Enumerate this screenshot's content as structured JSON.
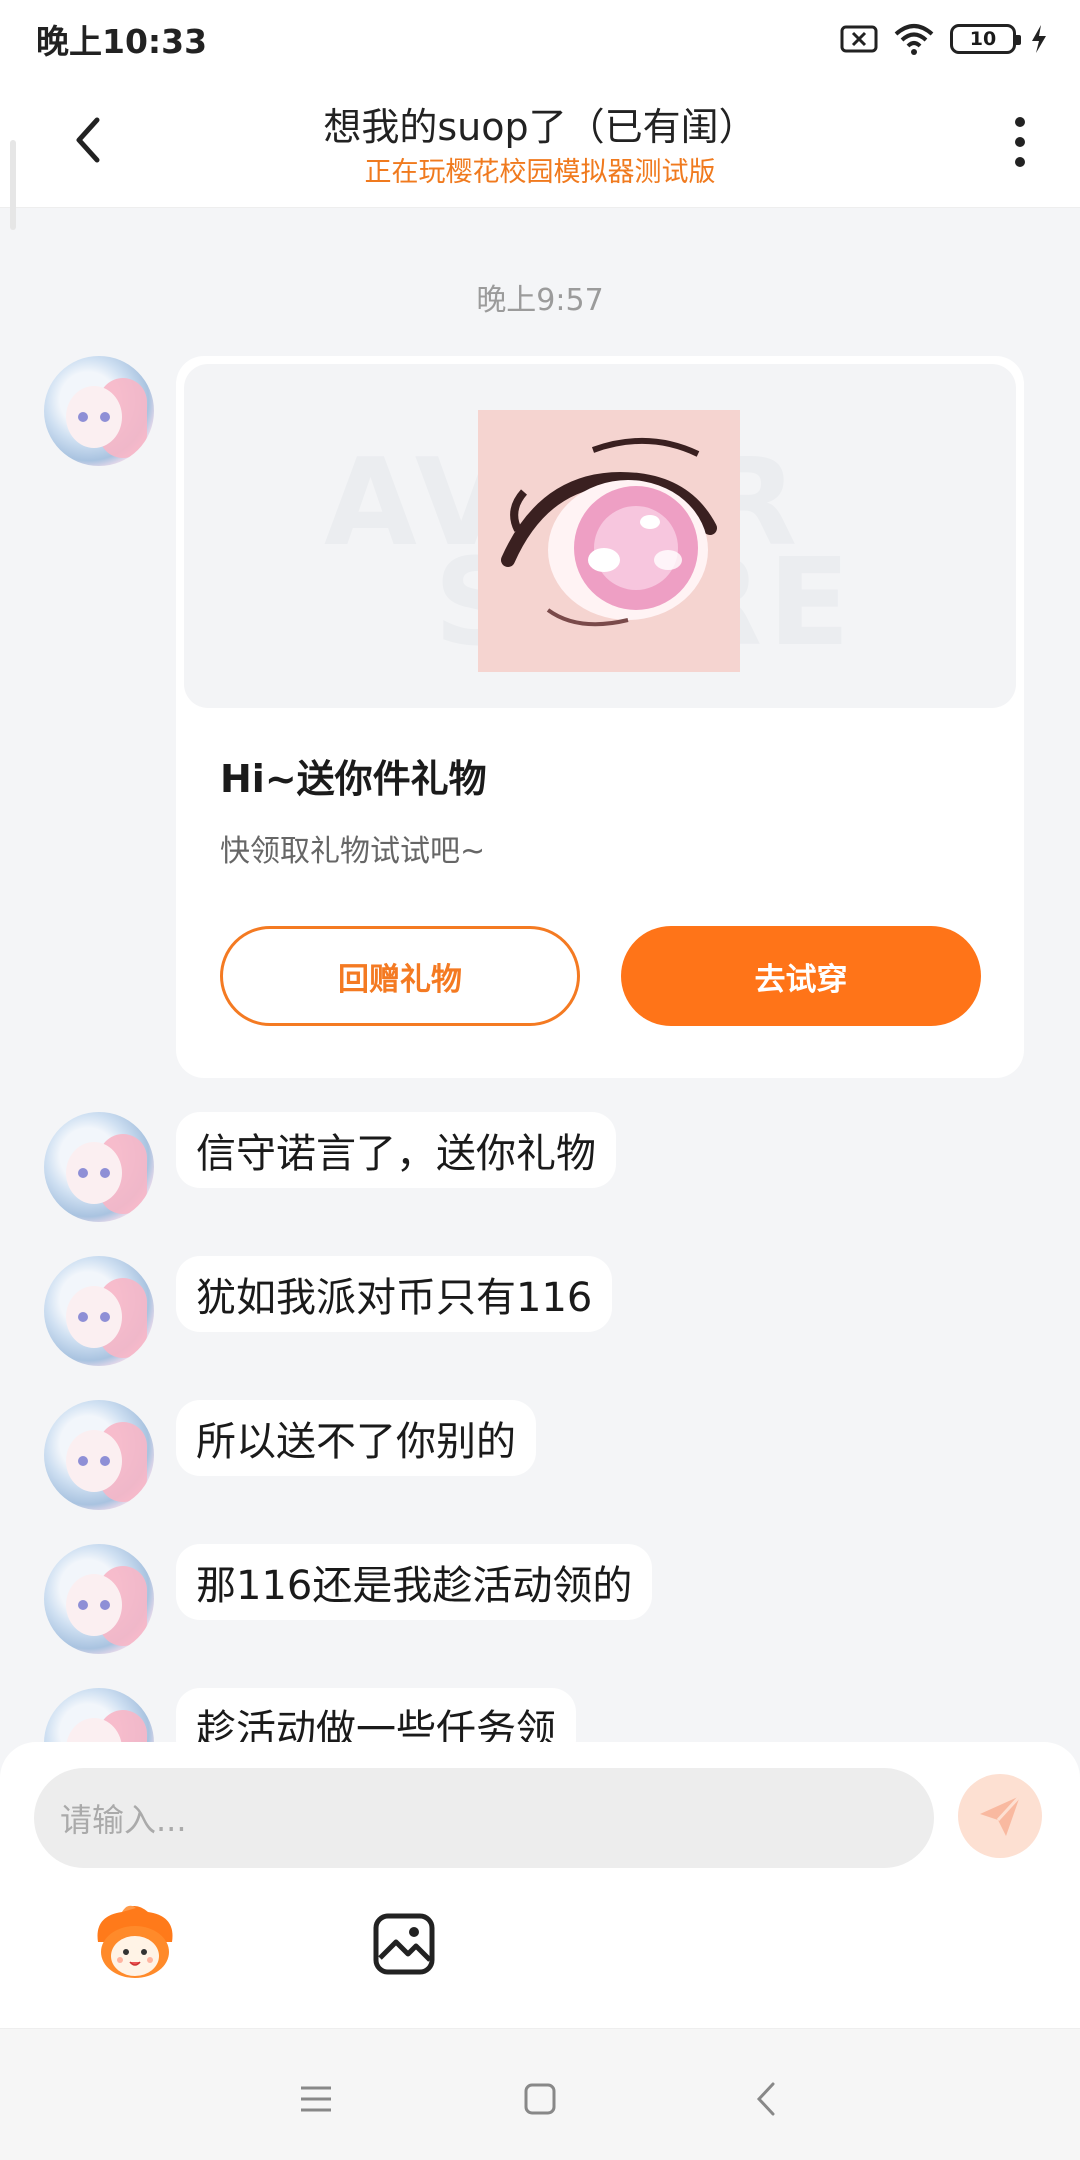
{
  "status_bar": {
    "time": "晚上10:33",
    "battery": "10"
  },
  "header": {
    "title": "想我的suop了（已有闺）",
    "subtitle": "正在玩樱花校园模拟器测试版"
  },
  "chat": {
    "timestamp": "晚上9:57",
    "gift_card": {
      "title": "Hi~送你件礼物",
      "desc": "快领取礼物试试吧~",
      "return_gift_label": "回赠礼物",
      "try_on_label": "去试穿"
    },
    "messages": [
      {
        "text": "信守诺言了，送你礼物"
      },
      {
        "text": "犹如我派对币只有116"
      },
      {
        "text": "所以送不了你别的"
      },
      {
        "text": "那116还是我趁活动领的"
      },
      {
        "text": "趁活动做一些任务领"
      }
    ]
  },
  "composer": {
    "placeholder": "请输入..."
  },
  "colors": {
    "accent": "#ff7418",
    "subtitle": "#f07a1e"
  }
}
